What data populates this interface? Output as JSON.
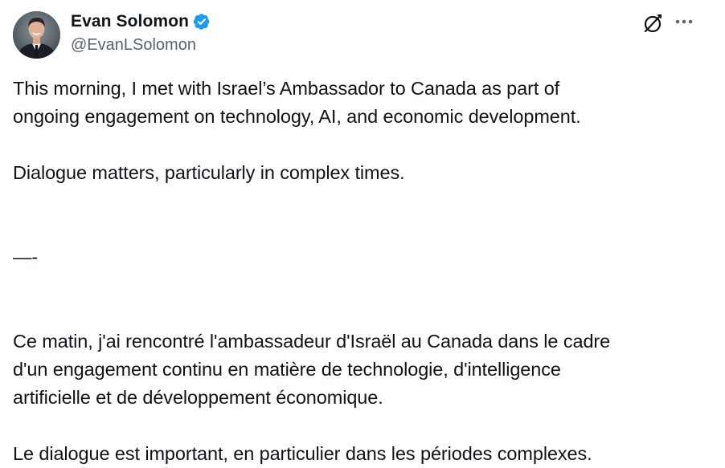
{
  "author": {
    "display_name": "Evan Solomon",
    "handle": "@EvanLSolomon",
    "verified": true,
    "avatar_icon": "profile-photo"
  },
  "actions": {
    "grok_icon": "grok-icon",
    "more_icon": "more-horizontal-icon"
  },
  "tweet": {
    "para1": "This morning, I met with Israel’s Ambassador to Canada as part of\nongoing engagement on technology, AI, and economic development.",
    "para2": "Dialogue matters, particularly in complex times.",
    "separator": "—-",
    "para3": "Ce matin, j'ai rencontré l'ambassadeur d'Israël au Canada dans le cadre\nd'un engagement continu en matière de technologie, d'intelligence\nartificielle et de développement économique.",
    "para4": "Le dialogue est important, en particulier dans les périodes complexes."
  },
  "colors": {
    "text": "#0f1419",
    "secondary": "#536471",
    "verified_blue": "#1d9bf0"
  }
}
